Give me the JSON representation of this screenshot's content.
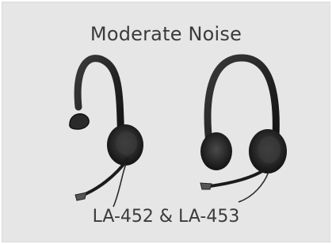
{
  "card": {
    "title": "Moderate Noise",
    "caption": "LA-452 & LA-453"
  },
  "images": {
    "left": "monaural-headset-icon",
    "right": "binaural-headset-icon"
  },
  "colors": {
    "background": "#e6e6e6",
    "text": "#3b3b3b",
    "headset": "#1f1f1f"
  }
}
